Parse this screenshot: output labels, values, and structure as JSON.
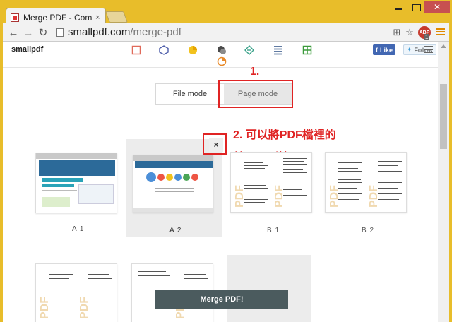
{
  "browser": {
    "tab_title": "Merge PDF - Combine P",
    "tab_close": "×",
    "url_host": "smallpdf.com",
    "url_path": "/merge-pdf",
    "abp_label": "ABP",
    "abp_count": "1"
  },
  "site": {
    "logo": "smallpdf",
    "fb_like": "Like",
    "tw_follow": "Follow",
    "tool_icon_colors": [
      "#e06a5a",
      "#4a5aa8",
      "#f2c21d",
      "#4a4a4a",
      "#3aa28a",
      "#3a5a8a",
      "#3a9a3a",
      "#e88a2a"
    ]
  },
  "modes": {
    "file_mode": "File mode",
    "page_mode": "Page mode",
    "active": "Page mode"
  },
  "annotations": {
    "step1": "1.",
    "step2_line1": "2. 可以將PDF檔裡的",
    "step2_line2": "某一頁刪掉。",
    "color": "#e02424"
  },
  "close_button": "×",
  "pages": [
    {
      "label": "A 1",
      "kind": "screenshot-blog",
      "selected": false
    },
    {
      "label": "A 2",
      "kind": "screenshot-google",
      "selected": true
    },
    {
      "label": "B 1",
      "kind": "pdf-document",
      "selected": false
    },
    {
      "label": "B 2",
      "kind": "pdf-document",
      "selected": false
    }
  ],
  "merge_button": "Merge PDF!"
}
